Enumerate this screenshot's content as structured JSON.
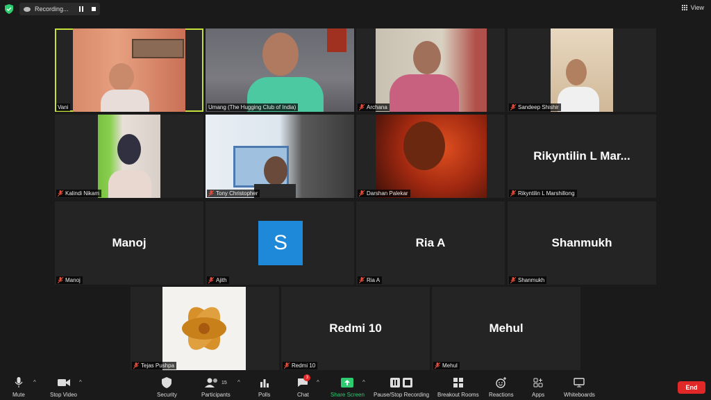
{
  "top": {
    "recording_label": "Recording...",
    "view_label": "View"
  },
  "participants": [
    {
      "name": "Vani",
      "kind": "video",
      "active": true,
      "muted": false
    },
    {
      "name": "Umang (The Hugging Club of India)",
      "kind": "video",
      "muted": false
    },
    {
      "name": "Archana",
      "kind": "video",
      "muted": true
    },
    {
      "name": "Sandeep Shishir",
      "kind": "video",
      "muted": true
    },
    {
      "name": "Kalindi Nikam",
      "kind": "video",
      "muted": true
    },
    {
      "name": "Tony Christopher",
      "kind": "video",
      "muted": true
    },
    {
      "name": "Darshan Palekar",
      "kind": "video",
      "muted": true
    },
    {
      "name": "Rikyntilin L Marshillong",
      "display": "Rikyntilin L Mar...",
      "kind": "name",
      "muted": true
    },
    {
      "name": "Manoj",
      "display": "Manoj",
      "kind": "name",
      "muted": true
    },
    {
      "name": "Ajith",
      "avatar_letter": "S",
      "kind": "avatar",
      "muted": true
    },
    {
      "name": "Ria A",
      "display": "Ria A",
      "kind": "name",
      "muted": true
    },
    {
      "name": "Shanmukh",
      "display": "Shanmukh",
      "kind": "name",
      "muted": true
    },
    {
      "name": "Tejas Pushpa",
      "kind": "video",
      "muted": true
    },
    {
      "name": "Redmi 10",
      "display": "Redmi 10",
      "kind": "name",
      "muted": true
    },
    {
      "name": "Mehul",
      "display": "Mehul",
      "kind": "name",
      "muted": true
    }
  ],
  "toolbar": {
    "mute": "Mute",
    "stop_video": "Stop Video",
    "security": "Security",
    "participants": "Participants",
    "participants_count": "15",
    "polls": "Polls",
    "chat": "Chat",
    "chat_badge": "3",
    "share_screen": "Share Screen",
    "pause_recording": "Pause/Stop Recording",
    "breakout_rooms": "Breakout Rooms",
    "reactions": "Reactions",
    "apps": "Apps",
    "whiteboards": "Whiteboards",
    "end": "End"
  },
  "colors": {
    "active_border": "#c8e03c",
    "end_button": "#e02828",
    "share_green": "#2ecc71",
    "avatar_blue": "#1e88d9"
  }
}
